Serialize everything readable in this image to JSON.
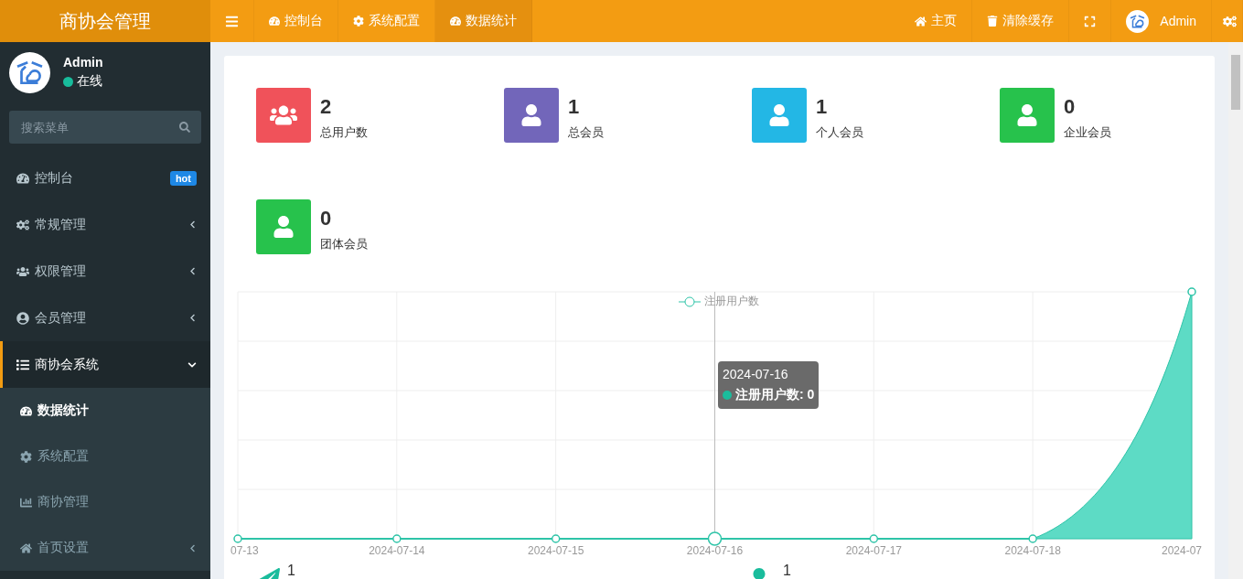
{
  "brand": {
    "title": "商协会管理"
  },
  "top_nav": {
    "tabs": [
      {
        "label": "控制台",
        "selected": false
      },
      {
        "label": "系统配置",
        "selected": false
      },
      {
        "label": "数据统计",
        "selected": true
      }
    ],
    "right": [
      {
        "kind": "link",
        "label": "主页"
      },
      {
        "kind": "link",
        "label": "清除缓存"
      },
      {
        "kind": "fullscreen"
      },
      {
        "kind": "user",
        "label": "Admin"
      },
      {
        "kind": "settings"
      }
    ]
  },
  "user_panel": {
    "name": "Admin",
    "status": "在线",
    "online": true
  },
  "search": {
    "placeholder": "搜索菜单"
  },
  "sidebar": {
    "items": [
      {
        "label": "控制台",
        "badge": "hot",
        "selected": false
      },
      {
        "label": "常规管理",
        "expanded": false,
        "selected": false
      },
      {
        "label": "权限管理",
        "expanded": false,
        "selected": false
      },
      {
        "label": "会员管理",
        "expanded": false,
        "selected": false
      },
      {
        "label": "商协会系统",
        "expanded": true,
        "selected": true,
        "children": [
          {
            "label": "数据统计",
            "selected": true
          },
          {
            "label": "系统配置",
            "selected": false
          },
          {
            "label": "商协管理",
            "selected": false
          },
          {
            "label": "首页设置",
            "selected": false,
            "expanded": false
          }
        ]
      }
    ]
  },
  "stats": [
    {
      "value": "2",
      "label": "总用户数",
      "color": "#f0525a",
      "kind": "group"
    },
    {
      "value": "1",
      "label": "总会员",
      "color": "#7266ba",
      "kind": "user"
    },
    {
      "value": "1",
      "label": "个人会员",
      "color": "#23b7e5",
      "kind": "user"
    },
    {
      "value": "0",
      "label": "企业会员",
      "color": "#27c24c",
      "kind": "user"
    },
    {
      "value": "0",
      "label": "团体会员",
      "color": "#27c24c",
      "kind": "user"
    }
  ],
  "chart": {
    "legend": "注册用户数",
    "x_labels": [
      "07-13",
      "2024-07-14",
      "2024-07-15",
      "2024-07-16",
      "2024-07-17",
      "2024-07-18",
      "2024-07"
    ],
    "tooltip": {
      "title": "2024-07-16",
      "line": "注册用户数: 0"
    }
  },
  "bottom_stats": [
    {
      "value": "1",
      "color": "#1abc9c"
    },
    {
      "value": "1",
      "color": "#1abc9c"
    }
  ]
}
